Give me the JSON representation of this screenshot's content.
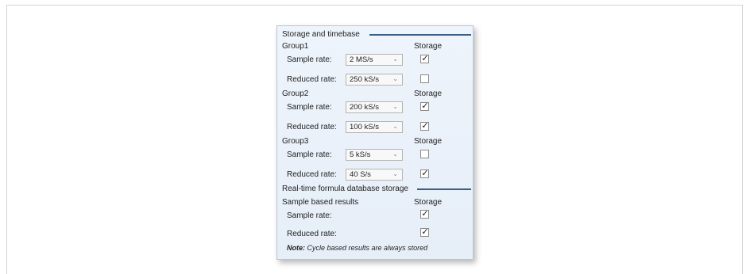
{
  "storage_timebase": {
    "title": "Storage and timebase",
    "groups": [
      {
        "name": "Group1",
        "storage_label": "Storage",
        "sample_label": "Sample rate:",
        "sample_value": "2 MS/s",
        "sample_checked": true,
        "reduced_label": "Reduced rate:",
        "reduced_value": "250 kS/s",
        "reduced_checked": false
      },
      {
        "name": "Group2",
        "storage_label": "Storage",
        "sample_label": "Sample rate:",
        "sample_value": "200 kS/s",
        "sample_checked": true,
        "reduced_label": "Reduced rate:",
        "reduced_value": "100 kS/s",
        "reduced_checked": true
      },
      {
        "name": "Group3",
        "storage_label": "Storage",
        "sample_label": "Sample rate:",
        "sample_value": "5 kS/s",
        "sample_checked": false,
        "reduced_label": "Reduced rate:",
        "reduced_value": "40 S/s",
        "reduced_checked": true
      }
    ]
  },
  "realtime": {
    "title": "Real-time formula database storage",
    "subtitle": "Sample based results",
    "storage_label": "Storage",
    "sample_label": "Sample rate:",
    "sample_checked": true,
    "reduced_label": "Reduced rate:",
    "reduced_checked": true,
    "note_prefix": "Note:",
    "note_text": "Cycle based results are always stored"
  },
  "icons": {
    "check": "checkmark-icon",
    "dropdown": "chevron-down-icon"
  }
}
